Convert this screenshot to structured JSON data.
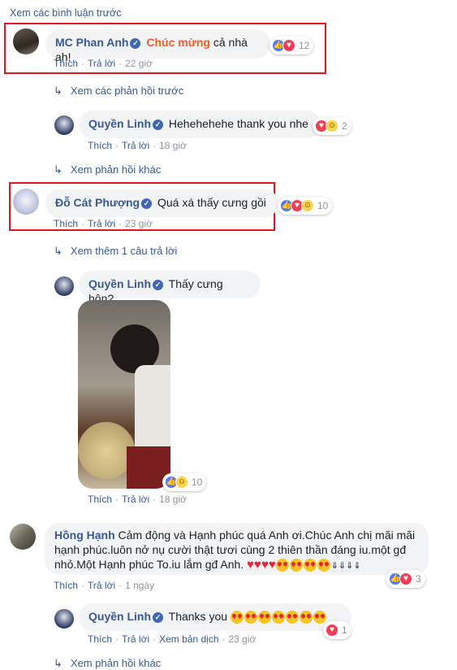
{
  "top_link": "Xem các bình luận trước",
  "comments": [
    {
      "name": "MC Phan Anh",
      "highlight": "Chúc mừng",
      "text": " cả nhà ah!",
      "reactions": "12",
      "like": "Thích",
      "reply": "Trả lời",
      "time": "22 giờ"
    },
    {
      "name": "Đỗ Cát Phượng",
      "text": "Quá xá thấy cưng gồi",
      "reactions": "10",
      "like": "Thích",
      "reply": "Trả lời",
      "time": "23 giờ"
    },
    {
      "name": "Hồng Hạnh",
      "text": "Cảm động và Hạnh phúc quá Anh ơi.Chúc Anh chị mãi mãi hạnh phúc.luôn nở nụ cười thật tươi cùng 2 thiên thần đáng iu.một gđ nhỏ.Một Hạnh phúc To.iu lắm gđ Anh.",
      "reactions": "3",
      "like": "Thích",
      "reply": "Trả lời",
      "time": "1 ngày"
    }
  ],
  "replies": [
    {
      "name": "Quyền Linh",
      "text": "Hehehehehe thank you nhe",
      "reactions": "2",
      "like": "Thích",
      "reply": "Trả lời",
      "time": "18 giờ"
    },
    {
      "name": "Quyền Linh",
      "text": "Thấy cưng hôn?",
      "reactions": "10",
      "like": "Thích",
      "reply": "Trả lời",
      "time": "18 giờ"
    },
    {
      "name": "Quyền Linh",
      "text": "Thanks you",
      "reactions": "1",
      "like": "Thích",
      "reply": "Trả lời",
      "translate": "Xem bản dịch",
      "time": "23 giờ"
    }
  ],
  "thread_links": {
    "prev_replies": "Xem các phản hồi trước",
    "other_replies_1": "Xem phản hồi khác",
    "more_one": "Xem thêm 1 câu trả lời",
    "other_replies_2": "Xem phản hồi khác"
  },
  "colors": {
    "link": "#385898",
    "highlight": "#f25c26",
    "box": "#e0171e",
    "bubble": "#f2f3f5"
  }
}
